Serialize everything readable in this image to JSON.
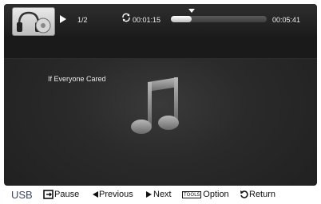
{
  "player": {
    "track_count": "1/2",
    "elapsed": "00:01:15",
    "total": "00:05:41",
    "progress_fraction": 0.22,
    "song_title": "If Everyone Cared"
  },
  "bottom_bar": {
    "source": "USB",
    "pause_label": "Pause",
    "previous_label": "Previous",
    "next_label": "Next",
    "tools_badge": "TOOLS",
    "option_label": "Option",
    "return_label": "Return"
  },
  "icons": {
    "thumbnail": "music-thumbnail-icon",
    "play": "play-icon",
    "repeat": "repeat-icon",
    "note": "music-note-icon",
    "pause": "pause-enter-icon",
    "previous": "previous-arrow-icon",
    "next": "next-arrow-icon",
    "return": "return-icon"
  },
  "colors": {
    "screen_bg": "#2a2a2a",
    "text": "#f0f0f0",
    "source_text": "#3f4a66"
  }
}
